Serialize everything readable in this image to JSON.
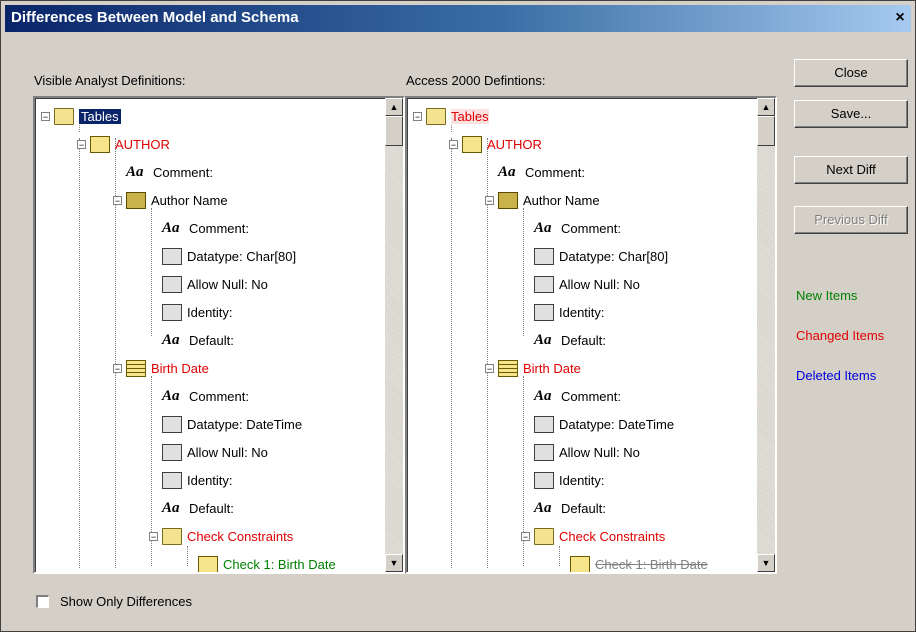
{
  "window": {
    "title": "Differences Between Model and Schema",
    "close_glyph": "×"
  },
  "left_panel": {
    "label": "Visible Analyst Definitions:",
    "items": [
      {
        "label": "Tables",
        "icon": "folder-icon",
        "style": "selected"
      },
      {
        "label": "AUTHOR",
        "icon": "table-icon",
        "style": "changed"
      },
      {
        "label": "Comment:",
        "icon": "text-aa-icon",
        "style": "normal"
      },
      {
        "label": "Author Name",
        "icon": "key-column-icon",
        "style": "normal"
      },
      {
        "label": "Comment:",
        "icon": "text-aa-icon",
        "style": "normal"
      },
      {
        "label": "Datatype:  Char[80]",
        "icon": "property-icon",
        "style": "normal"
      },
      {
        "label": "Allow Null:  No",
        "icon": "property-icon",
        "style": "normal"
      },
      {
        "label": "Identity:",
        "icon": "property-icon",
        "style": "normal"
      },
      {
        "label": "Default:",
        "icon": "text-aa-icon",
        "style": "normal"
      },
      {
        "label": "Birth Date",
        "icon": "column-icon",
        "style": "changed"
      },
      {
        "label": "Comment:",
        "icon": "text-aa-icon",
        "style": "normal"
      },
      {
        "label": "Datatype:  DateTime",
        "icon": "property-icon",
        "style": "normal"
      },
      {
        "label": "Allow Null:  No",
        "icon": "property-icon",
        "style": "normal"
      },
      {
        "label": "Identity:",
        "icon": "property-icon",
        "style": "normal"
      },
      {
        "label": "Default:",
        "icon": "text-aa-icon",
        "style": "normal"
      },
      {
        "label": "Check Constraints",
        "icon": "folder-icon",
        "style": "changed"
      },
      {
        "label": "Check 1:  Birth Date",
        "icon": "check-icon",
        "style": "new"
      }
    ]
  },
  "right_panel": {
    "label": "Access 2000 Defintions:",
    "items": [
      {
        "label": "Tables",
        "icon": "folder-icon",
        "style": "changed-hl"
      },
      {
        "label": "AUTHOR",
        "icon": "table-icon",
        "style": "changed"
      },
      {
        "label": "Comment:",
        "icon": "text-aa-icon",
        "style": "normal"
      },
      {
        "label": "Author Name",
        "icon": "key-column-icon",
        "style": "normal"
      },
      {
        "label": "Comment:",
        "icon": "text-aa-icon",
        "style": "normal"
      },
      {
        "label": "Datatype:  Char[80]",
        "icon": "property-icon",
        "style": "normal"
      },
      {
        "label": "Allow Null:  No",
        "icon": "property-icon",
        "style": "normal"
      },
      {
        "label": "Identity:",
        "icon": "property-icon",
        "style": "normal"
      },
      {
        "label": "Default:",
        "icon": "text-aa-icon",
        "style": "normal"
      },
      {
        "label": "Birth Date",
        "icon": "column-icon",
        "style": "changed"
      },
      {
        "label": "Comment:",
        "icon": "text-aa-icon",
        "style": "normal"
      },
      {
        "label": "Datatype:  DateTime",
        "icon": "property-icon",
        "style": "normal"
      },
      {
        "label": "Allow Null:  No",
        "icon": "property-icon",
        "style": "normal"
      },
      {
        "label": "Identity:",
        "icon": "property-icon",
        "style": "normal"
      },
      {
        "label": "Default:",
        "icon": "text-aa-icon",
        "style": "normal"
      },
      {
        "label": "Check Constraints",
        "icon": "folder-icon",
        "style": "changed"
      },
      {
        "label": "Check 1:  Birth Date",
        "icon": "check-icon",
        "style": "deleted"
      }
    ]
  },
  "buttons": {
    "close": "Close",
    "save": "Save...",
    "next_diff": "Next Diff",
    "previous_diff": "Previous Diff"
  },
  "legend": {
    "new": "New Items",
    "changed": "Changed Items",
    "deleted": "Deleted Items"
  },
  "colors": {
    "new": "#008000",
    "changed": "#e00000",
    "deleted": "#0000e0",
    "dialog_bg": "#d4d0c8",
    "title_bar": "#0a246a"
  },
  "footer": {
    "show_only_differences": "Show Only Differences",
    "checked": false
  }
}
